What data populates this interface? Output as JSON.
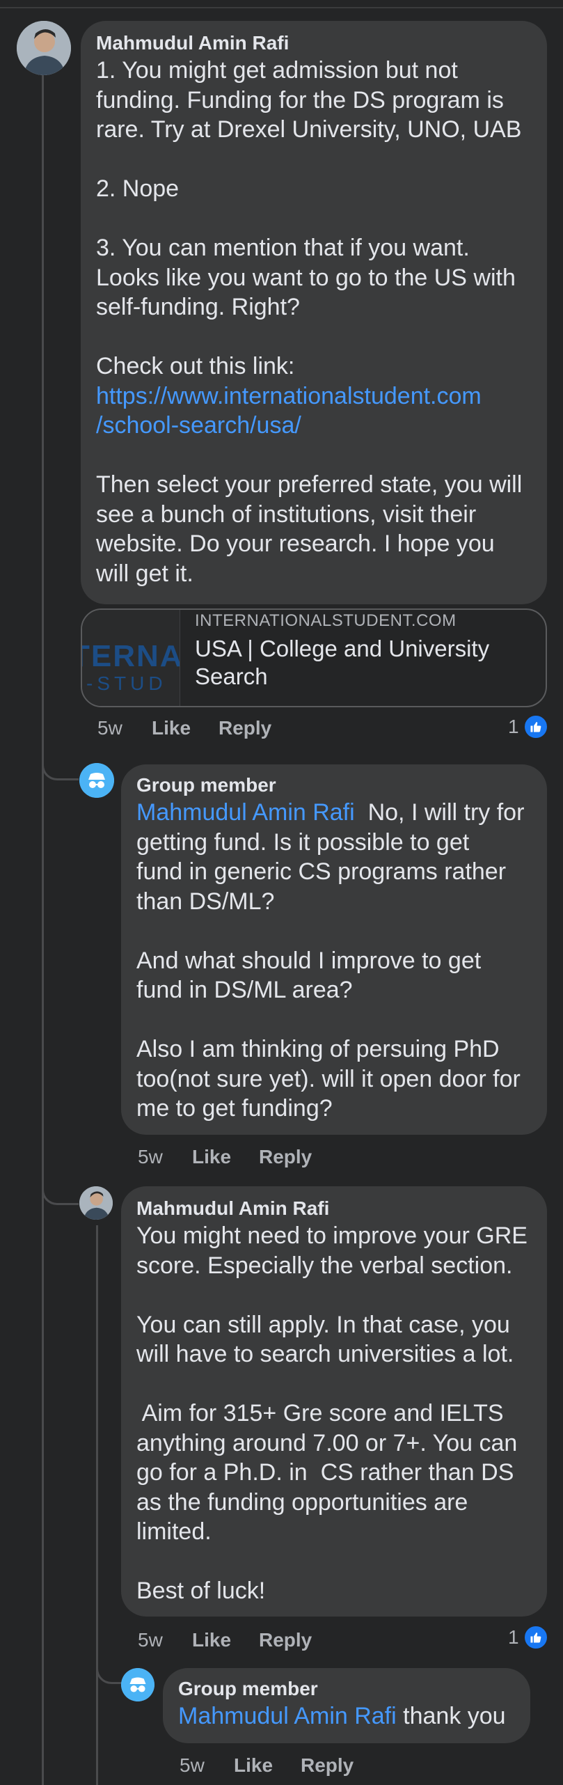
{
  "comments": [
    {
      "author": "Mahmudul Amin Rafi",
      "lines": [
        "1. You might get admission but not",
        "funding. Funding for the DS program is",
        "rare. Try at Drexel University, UNO, UAB",
        "",
        "2. Nope",
        "",
        "3. You can mention that if you want.",
        "Looks like you want to go to the US with",
        "self-funding. Right?",
        "",
        "Check out this link:"
      ],
      "link_lines": [
        "https://www.internationalstudent.com",
        "/school-search/usa/"
      ],
      "after_lines": [
        "Then select your preferred state, you will",
        "see a bunch of institutions, visit their",
        "website. Do your research. I hope you",
        "will get it."
      ],
      "preview": {
        "domain": "INTERNATIONALSTUDENT.COM",
        "title_line1": "USA | College and University",
        "title_line2": "Search",
        "thumb_text1": "TERNA",
        "thumb_text2": "-STUD"
      },
      "time": "5w",
      "like": "Like",
      "reply": "Reply",
      "reaction_count": "1"
    },
    {
      "author": "Group member",
      "mention": "Mahmudul Amin Rafi",
      "first_line_rest": "No, I will try for",
      "lines": [
        "getting fund. Is it possible to get",
        "fund in generic CS programs rather",
        "than DS/ML?",
        "",
        "And what should I improve to get",
        "fund in DS/ML area?",
        "",
        "Also I am thinking of persuing PhD",
        "too(not sure yet). will it open door for",
        "me to get funding?"
      ],
      "time": "5w",
      "like": "Like",
      "reply": "Reply"
    },
    {
      "author": "Mahmudul Amin Rafi",
      "lines": [
        "You might need to improve your GRE",
        "score. Especially the verbal section.",
        "",
        "You can still apply. In that case, you",
        "will have to search universities a lot.",
        "",
        " Aim for 315+ Gre score and IELTS",
        "anything around 7.00 or 7+. You can",
        "go for a Ph.D. in  CS rather than DS",
        "as the funding opportunities are",
        "limited.",
        "",
        "Best of luck!"
      ],
      "time": "5w",
      "like": "Like",
      "reply": "Reply",
      "reaction_count": "1"
    },
    {
      "author": "Group member",
      "mention": "Mahmudul Amin Rafi",
      "first_line_rest": "thank you",
      "time": "5w",
      "like": "Like",
      "reply": "Reply"
    }
  ],
  "colors": {
    "background": "#242526",
    "bubble": "#3a3b3c",
    "link": "#4599ff",
    "like_blue": "#1877f2",
    "anon_avatar": "#4bb3f5"
  },
  "icons": [
    "profile-avatar",
    "anonymous-member-icon",
    "thumbs-up-icon"
  ]
}
